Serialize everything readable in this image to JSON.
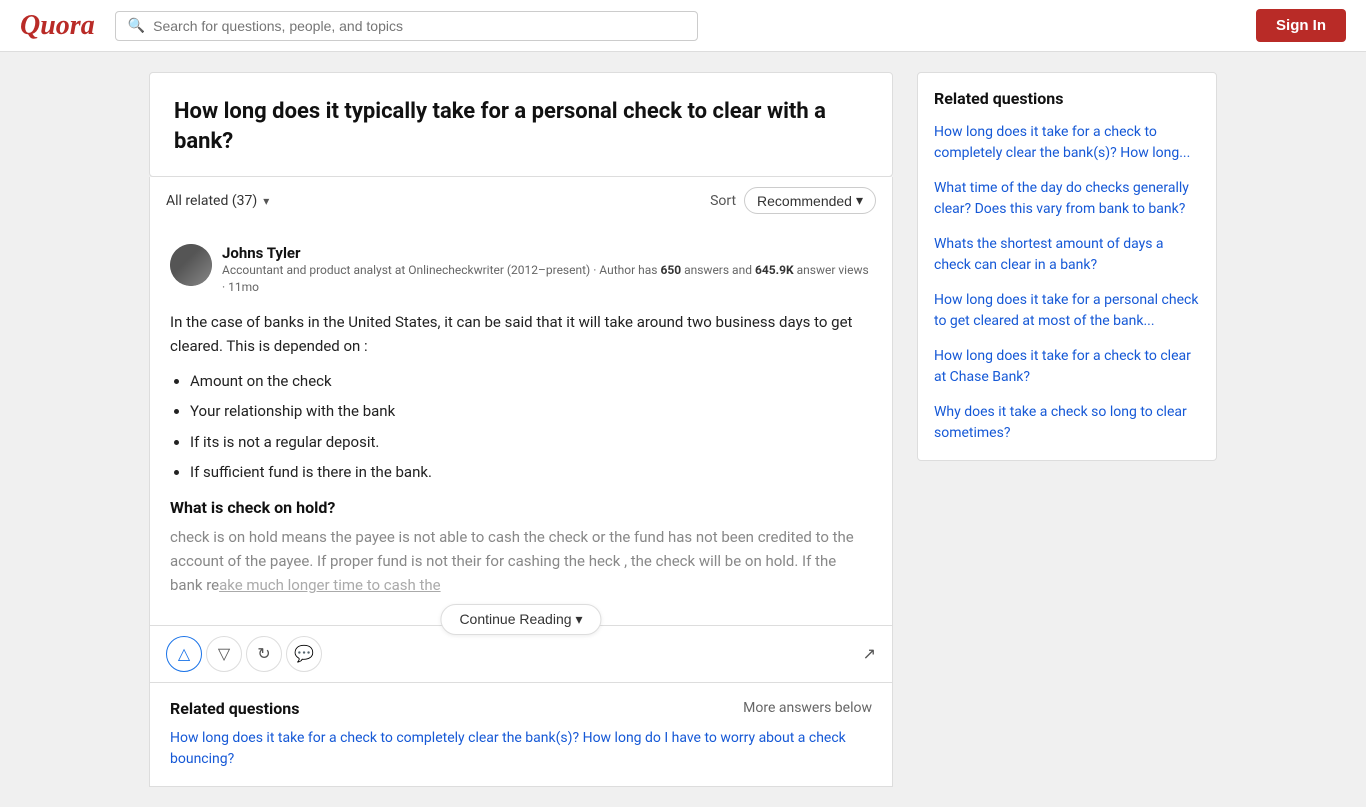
{
  "header": {
    "logo": "Quora",
    "search_placeholder": "Search for questions, people, and topics",
    "sign_in_label": "Sign In"
  },
  "question": {
    "title": "How long does it typically take for a personal check to clear with a bank?"
  },
  "filter_bar": {
    "all_related_label": "All related (37)",
    "sort_label": "Sort",
    "recommended_label": "Recommended"
  },
  "answer": {
    "author_name": "Johns Tyler",
    "author_meta": "Accountant and product analyst at Onlinecheckwriter (2012–present) · Author has",
    "answer_count": "650",
    "answer_count_suffix": "answers and",
    "views": "645.9K",
    "views_suffix": "answer views · 11mo",
    "intro": "In the case of banks in the United States, it can be said that it will take around two business days to get cleared. This is depended on :",
    "bullets": [
      "Amount on the check",
      "Your relationship with the bank",
      "If its is not a regular deposit.",
      "If sufficient fund is there in the bank."
    ],
    "subheading": "What is check on hold?",
    "fade_text": "check is on hold means the payee is not able to cash the check or the fund has not been credited to the account of the payee. If proper fund is not their for cashing the heck , the check will be on hold. If the bank re",
    "fade_text2": "ake much longer time to cash the",
    "continue_reading_label": "Continue Reading"
  },
  "action_bar": {
    "upvote_title": "Upvote",
    "downvote_title": "Downvote",
    "share_title": "Share",
    "comment_title": "Comment",
    "rotate_title": "Rotate"
  },
  "related_inline": {
    "title": "Related questions",
    "more_answers": "More answers below",
    "link": "How long does it take for a check to completely clear the bank(s)? How long do I have to worry about a check bouncing?"
  },
  "sidebar": {
    "title": "Related questions",
    "links": [
      "How long does it take for a check to completely clear the bank(s)? How long...",
      "What time of the day do checks generally clear? Does this vary from bank to bank?",
      "Whats the shortest amount of days a check can clear in a bank?",
      "How long does it take for a personal check to get cleared at most of the bank...",
      "How long does it take for a check to clear at Chase Bank?",
      "Why does it take a check so long to clear sometimes?"
    ]
  }
}
